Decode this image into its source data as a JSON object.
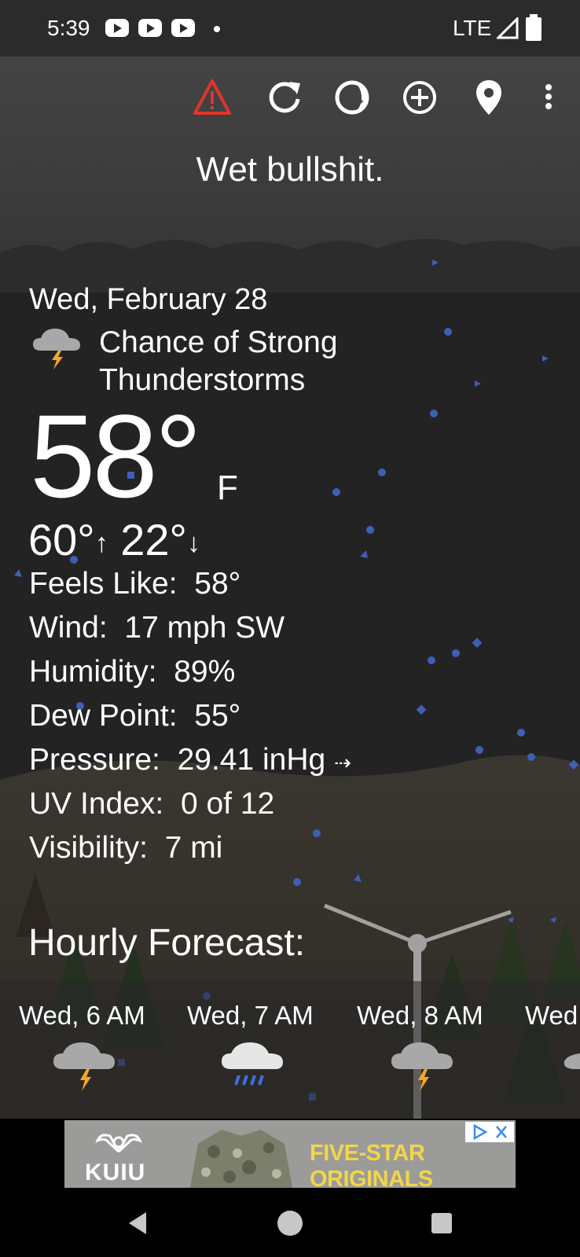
{
  "status_bar": {
    "time": "5:39",
    "network": "LTE",
    "icons": [
      "youtube-icon",
      "youtube-icon",
      "youtube-icon",
      "notification-dot",
      "signal-icon",
      "battery-icon"
    ]
  },
  "toolbar": {
    "icons": [
      "alert-icon",
      "refresh-icon",
      "moon-phase-icon",
      "add-location-icon",
      "location-pin-icon",
      "more-vert-icon"
    ]
  },
  "header": {
    "title": "Wet bullshit."
  },
  "current": {
    "date": "Wed, February 28",
    "condition": "Chance of Strong Thunderstorms",
    "condition_icon": "thunderstorm-cloud-icon",
    "temperature": "58°",
    "unit": "F",
    "high": "60°",
    "low": "22°",
    "details": [
      {
        "label": "Feels Like:",
        "value": "58°"
      },
      {
        "label": "Wind:",
        "value": "17 mph SW"
      },
      {
        "label": "Humidity:",
        "value": "89%"
      },
      {
        "label": "Dew Point:",
        "value": "55°"
      },
      {
        "label": "Pressure:",
        "value": "29.41 inHg"
      },
      {
        "label": "UV Index:",
        "value": "0 of 12"
      },
      {
        "label": "Visibility:",
        "value": "7 mi"
      }
    ]
  },
  "hourly": {
    "title": "Hourly Forecast:",
    "items": [
      {
        "label": "Wed, 6 AM",
        "icon": "thunderstorm-cloud-icon"
      },
      {
        "label": "Wed, 7 AM",
        "icon": "rain-cloud-icon"
      },
      {
        "label": "Wed, 8 AM",
        "icon": "thunderstorm-cloud-icon"
      },
      {
        "label": "Wed",
        "icon": "cloud-icon"
      }
    ]
  },
  "ad": {
    "brand": "KUIU",
    "tagline": "FIVE-STAR ORIGINALS",
    "icons": [
      "adchoices-icon",
      "close-ad-icon"
    ]
  },
  "colors": {
    "alert": "#e0352b",
    "rain_particles": "#3f5fb5",
    "bolt": "#f5a623",
    "ad_text": "#f2d54a"
  }
}
